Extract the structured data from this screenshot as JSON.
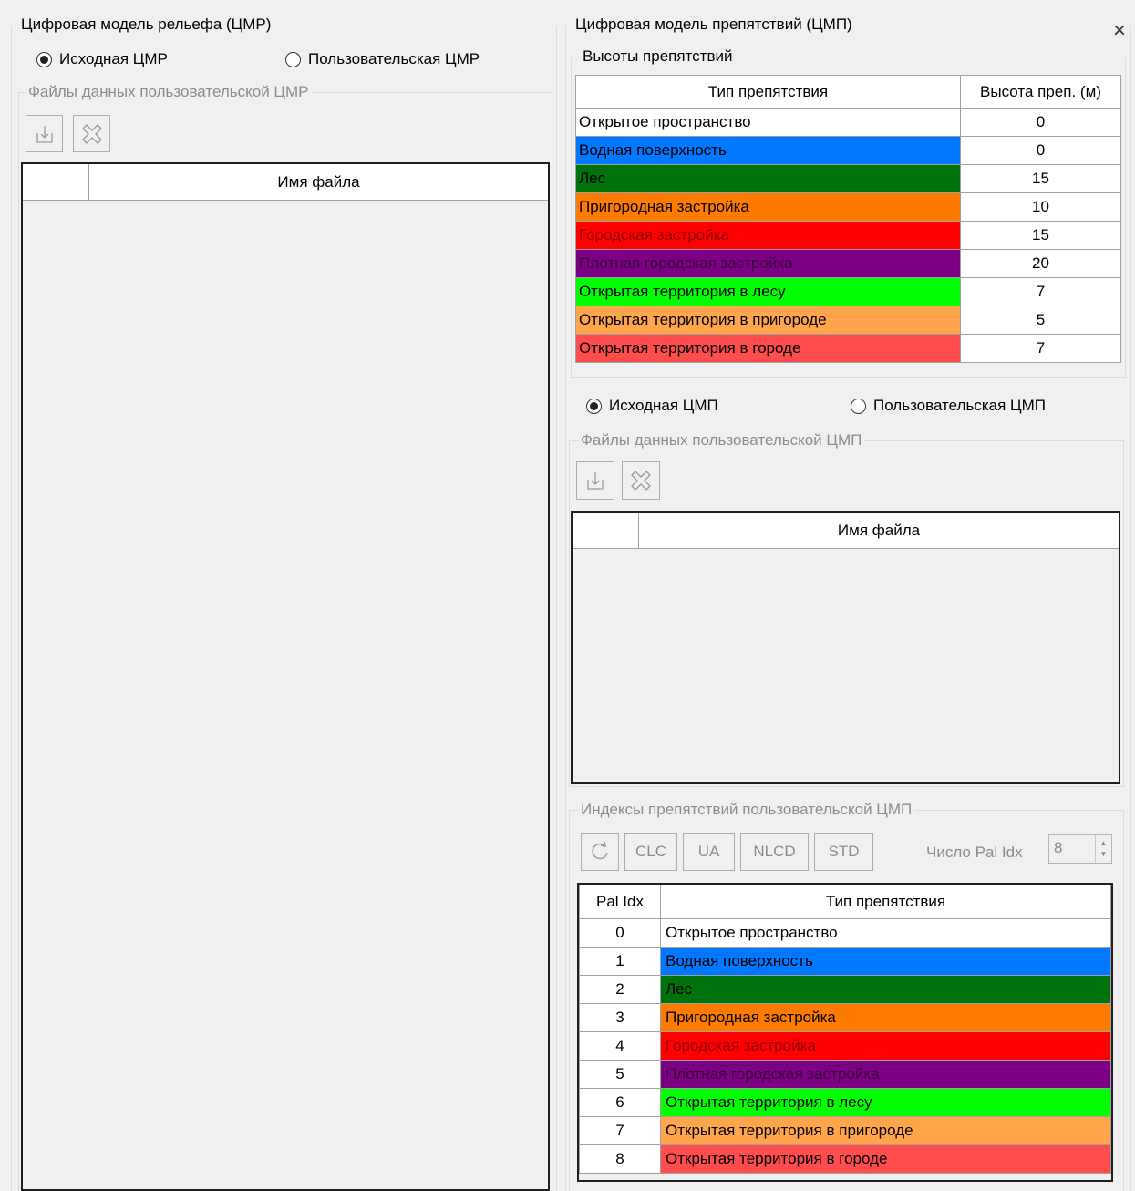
{
  "close_label": "×",
  "dem": {
    "title": "Цифровая модель рельефа (ЦМР)",
    "radio_source": "Исходная ЦМР",
    "radio_user": "Пользовательская ЦМР",
    "files_group": "Файлы данных пользовательской ЦМР",
    "files_col": "Имя файла"
  },
  "dom": {
    "title": "Цифровая модель препятствий (ЦМП)",
    "heights_group": "Высоты препятствий",
    "heights_headers": {
      "type": "Тип препятствия",
      "height": "Высота преп. (м)"
    },
    "radio_source": "Исходная ЦМП",
    "radio_user": "Пользовательская ЦМП",
    "files_group": "Файлы данных пользовательской ЦМП",
    "files_col": "Имя файла",
    "idx_group": "Индексы препятствий пользовательской ЦМП",
    "buttons": {
      "clc": "CLC",
      "ua": "UA",
      "nlcd": "NLCD",
      "std": "STD"
    },
    "pal_count_label": "Число Pal Idx",
    "pal_count_value": "8",
    "pal_headers": {
      "idx": "Pal Idx",
      "type": "Тип препятствия"
    }
  },
  "obstacles": [
    {
      "name": "Открытое пространство",
      "height": "0",
      "color": "#ffffff",
      "text_color": "#000000"
    },
    {
      "name": "Водная поверхность",
      "height": "0",
      "color": "#0078ff",
      "text_color": "#000000"
    },
    {
      "name": "Лес",
      "height": "15",
      "color": "#00720b",
      "text_color": "#000000"
    },
    {
      "name": "Пригородная застройка",
      "height": "10",
      "color": "#ff7b00",
      "text_color": "#000000"
    },
    {
      "name": "Городская застройка",
      "height": "15",
      "color": "#ff0000",
      "text_color": "#8b0000"
    },
    {
      "name": "Плотная городская застройка",
      "height": "20",
      "color": "#7b0083",
      "text_color": "#3a003a"
    },
    {
      "name": "Открытая территория в лесу",
      "height": "7",
      "color": "#00ff00",
      "text_color": "#000000"
    },
    {
      "name": "Открытая территория в пригороде",
      "height": "5",
      "color": "#ffa64d",
      "text_color": "#000000"
    },
    {
      "name": "Открытая территория в городе",
      "height": "7",
      "color": "#ff4d4d",
      "text_color": "#000000"
    }
  ],
  "palette": [
    {
      "idx": "0",
      "name": "Открытое пространство",
      "color": "#ffffff",
      "text_color": "#000000"
    },
    {
      "idx": "1",
      "name": "Водная поверхность",
      "color": "#0078ff",
      "text_color": "#000000"
    },
    {
      "idx": "2",
      "name": "Лес",
      "color": "#00720b",
      "text_color": "#000000"
    },
    {
      "idx": "3",
      "name": "Пригородная застройка",
      "color": "#ff7b00",
      "text_color": "#000000"
    },
    {
      "idx": "4",
      "name": "Городская застройка",
      "color": "#ff0000",
      "text_color": "#8b0000"
    },
    {
      "idx": "5",
      "name": "Плотная городская застройка",
      "color": "#7b0083",
      "text_color": "#3a003a"
    },
    {
      "idx": "6",
      "name": "Открытая территория в лесу",
      "color": "#00ff00",
      "text_color": "#000000"
    },
    {
      "idx": "7",
      "name": "Открытая территория в пригороде",
      "color": "#ffa64d",
      "text_color": "#000000"
    },
    {
      "idx": "8",
      "name": "Открытая территория в городе",
      "color": "#ff4d4d",
      "text_color": "#000000"
    }
  ]
}
